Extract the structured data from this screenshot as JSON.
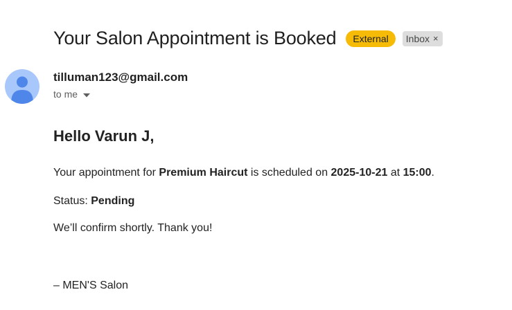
{
  "email": {
    "subject": "Your Salon Appointment is Booked",
    "labels": {
      "external": "External",
      "inbox": "Inbox",
      "inbox_close": "×"
    },
    "sender": "tilluman123@gmail.com",
    "recipient": "to me",
    "icons": [
      "avatar-person-icon",
      "chevron-down-icon",
      "close-icon"
    ],
    "colors": {
      "external_badge": "#f6bb07",
      "avatar_bg": "#a8c7fa",
      "avatar_figure": "#4f86ea"
    }
  },
  "body": {
    "greeting": "Hello Varun J,",
    "appointment": {
      "prefix": "Your appointment for ",
      "service": "Premium Haircut",
      "mid": " is scheduled on ",
      "date": "2025-10-21",
      "at": " at ",
      "time": "15:00",
      "end": "."
    },
    "status": {
      "label": "Status: ",
      "value": "Pending"
    },
    "confirm": "We’ll confirm shortly. Thank you!",
    "signature": "– MEN'S Salon"
  }
}
